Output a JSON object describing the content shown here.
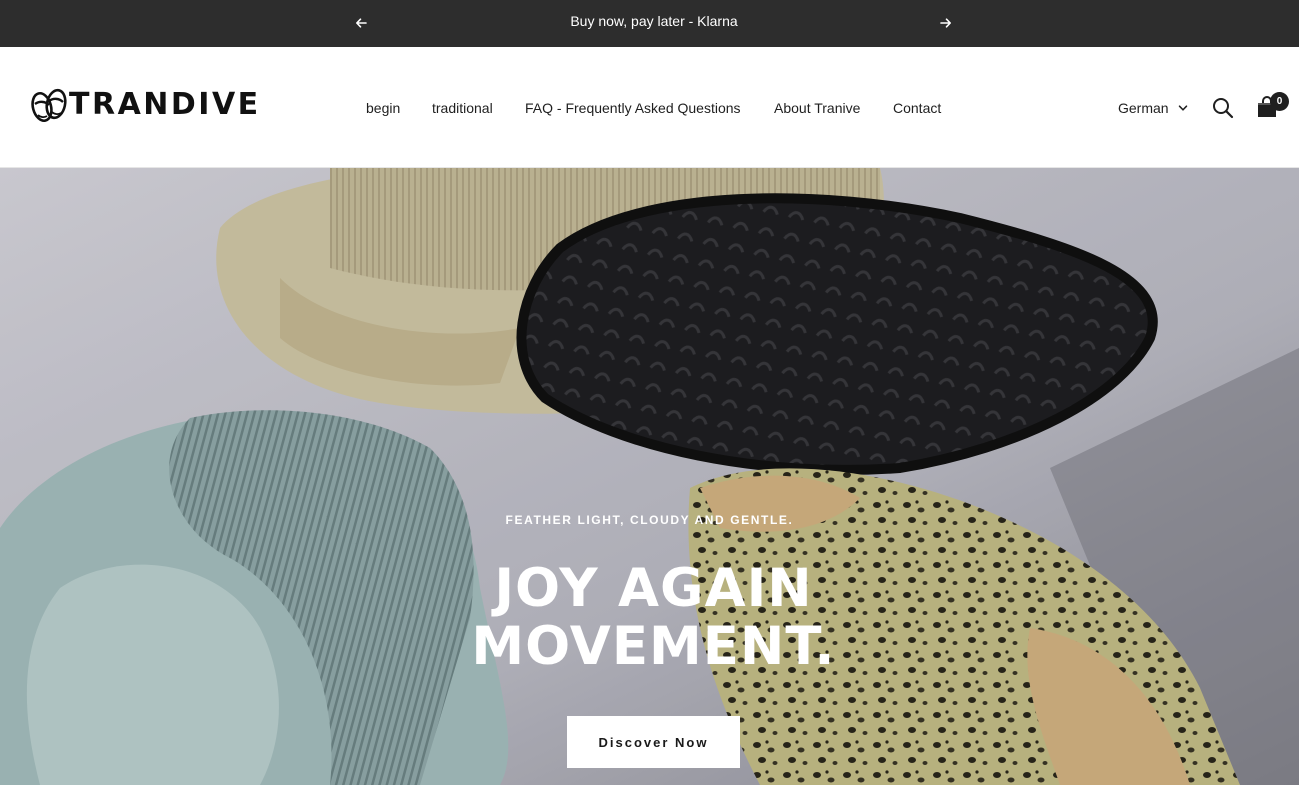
{
  "announcement": {
    "message": "Buy now, pay later - Klarna",
    "prev_icon": "arrow-left-icon",
    "next_icon": "arrow-right-icon"
  },
  "header": {
    "logo_text": "TRANDIVE",
    "logo_icon": "sandals-logo-icon",
    "nav": [
      {
        "label": "begin"
      },
      {
        "label": "traditional"
      },
      {
        "label": "FAQ - Frequently Asked Questions"
      },
      {
        "label": "About Tranive"
      },
      {
        "label": "Contact"
      }
    ],
    "language": "German",
    "search_icon": "search-icon",
    "cart_icon": "cart-icon",
    "cart_count": "0"
  },
  "hero": {
    "eyebrow": "FEATHER LIGHT, CLOUDY AND GENTLE.",
    "headline_line1": "JOY AGAIN",
    "headline_line2": "MOVEMENT.",
    "cta_label": "Discover Now"
  },
  "colors": {
    "announcement_bg": "#2d2d2d",
    "header_bg": "#ffffff",
    "text_dark": "#1f1f1f",
    "cta_bg": "#ffffff",
    "hero_text": "#ffffff"
  }
}
